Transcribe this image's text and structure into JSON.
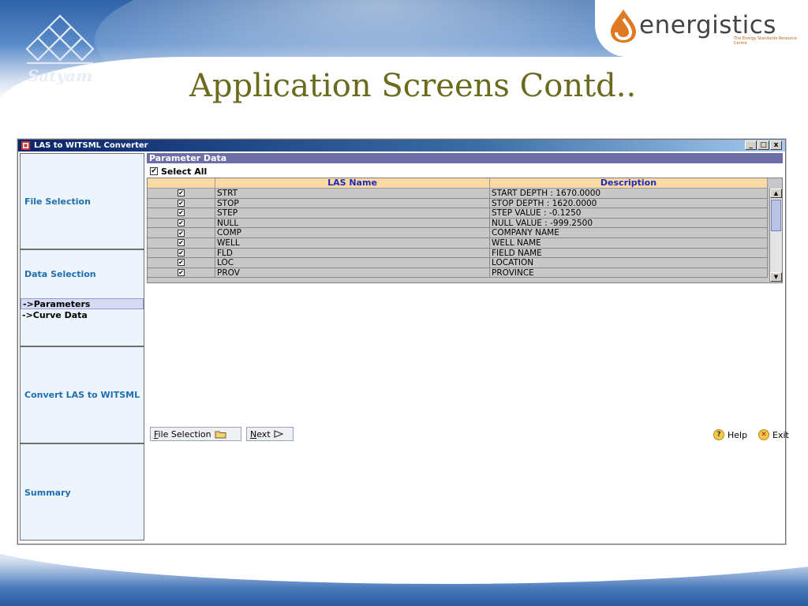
{
  "slide": {
    "title": "Application Screens Contd..",
    "logo_left_text": "Satyam",
    "logo_right_text": "energistics",
    "logo_right_tagline": "The Energy Standards Resource Centre"
  },
  "window": {
    "title": "LAS to WITSML Converter",
    "controls": [
      "_",
      "□",
      "x"
    ]
  },
  "nav": {
    "file_selection": "File Selection",
    "data_selection": "Data Selection",
    "sub_items": [
      "->Parameters",
      "->Curve Data"
    ],
    "convert": "Convert LAS to WITSML",
    "summary": "Summary"
  },
  "panel": {
    "header": "Parameter Data",
    "select_all": "Select All",
    "columns": [
      "",
      "LAS Name",
      "Description"
    ],
    "rows": [
      {
        "checked": true,
        "name": "STRT",
        "desc": "START DEPTH  : 1670.0000"
      },
      {
        "checked": true,
        "name": "STOP",
        "desc": "STOP DEPTH  : 1620.0000"
      },
      {
        "checked": true,
        "name": "STEP",
        "desc": "STEP VALUE  : -0.1250"
      },
      {
        "checked": true,
        "name": "NULL",
        "desc": "NULL VALUE  : -999.2500"
      },
      {
        "checked": true,
        "name": "COMP",
        "desc": "COMPANY NAME"
      },
      {
        "checked": true,
        "name": "WELL",
        "desc": "WELL NAME"
      },
      {
        "checked": true,
        "name": "FLD",
        "desc": "FIELD NAME"
      },
      {
        "checked": true,
        "name": "LOC",
        "desc": "LOCATION"
      },
      {
        "checked": true,
        "name": "PROV",
        "desc": "PROVINCE"
      }
    ]
  },
  "buttons": {
    "file_selection_first": "F",
    "file_selection_rest": "ile Selection",
    "next_first": "N",
    "next_rest": "ext",
    "help_first": "H",
    "help_rest": "elp",
    "exit_first": "E",
    "exit_second": "x",
    "exit_rest": "it"
  }
}
